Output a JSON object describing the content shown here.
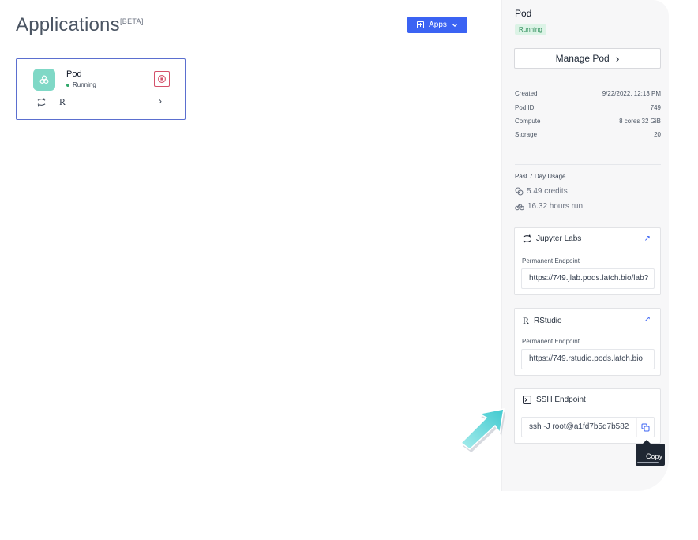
{
  "header": {
    "title": "Applications",
    "beta": "[BETA]",
    "apps_button": "Apps"
  },
  "pod_card": {
    "name": "Pod",
    "status": "Running",
    "r_label": "R",
    "chevron": "›"
  },
  "panel": {
    "title": "Pod",
    "status_badge": "Running",
    "manage_button": "Manage Pod",
    "manage_chevron": "›",
    "info": [
      {
        "label": "Created",
        "value": "9/22/2022, 12:13 PM"
      },
      {
        "label": "Pod ID",
        "value": "749"
      },
      {
        "label": "Compute",
        "value": "8 cores 32 GiB"
      },
      {
        "label": "Storage",
        "value": "20"
      }
    ],
    "usage": {
      "title": "Past 7 Day Usage",
      "credits": "5.49 credits",
      "hours": "16.32 hours run"
    },
    "jupyter": {
      "title": "Jupyter Labs",
      "sub": "Permanent Endpoint",
      "endpoint": "https://749.jlab.pods.latch.bio/lab?"
    },
    "rstudio": {
      "title": "RStudio",
      "r_glyph": "R",
      "sub": "Permanent Endpoint",
      "endpoint": "https://749.rstudio.pods.latch.bio"
    },
    "ssh": {
      "title": "SSH Endpoint",
      "endpoint": "ssh -J root@a1fd7b5d7b582"
    },
    "tooltip": "Copy",
    "external_arrow": "↗"
  },
  "colors": {
    "primary": "#3b63f3",
    "running_green": "#31a86b",
    "pod_logo_bg": "#7fd8c6",
    "stop_red": "#d4516a",
    "cursor_cyan": "#5fd3d3"
  },
  "icons": {
    "apps_button": "plus-box-icon",
    "dropdown": "chevron-down-icon",
    "pod_logo": "pod-logo-icon",
    "stop": "stop-icon",
    "jupyter": "jupyter-icon",
    "credits": "coins-icon",
    "hours": "bicycle-icon",
    "external": "external-link-icon",
    "terminal": "terminal-icon",
    "copy": "copy-icon",
    "cursor": "cursor-arrow-icon"
  }
}
